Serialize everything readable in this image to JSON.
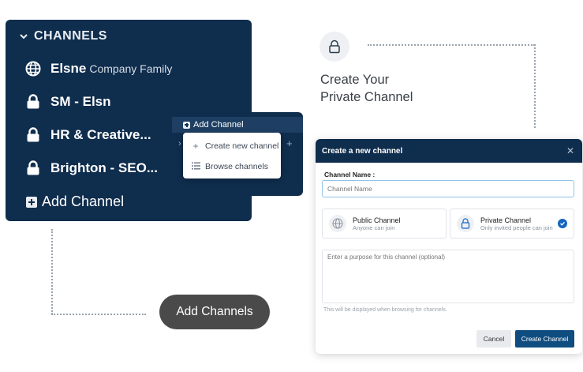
{
  "sidebar": {
    "header": "CHANNELS",
    "items": [
      {
        "name": "Elsne",
        "sub": "Company Family",
        "icon": "globe-icon"
      },
      {
        "name": "SM - Elsn",
        "icon": "lock-icon"
      },
      {
        "name": "HR & Creative...",
        "icon": "lock-icon"
      },
      {
        "name": "Brighton - SEO...",
        "icon": "lock-icon"
      }
    ],
    "add_label": "Add Channel"
  },
  "popover": {
    "strip_label": "Add Channel",
    "menu": [
      "Create new channel",
      "Browse channels"
    ]
  },
  "callouts": {
    "pill": "Add Channels",
    "heading_line1": "Create Your",
    "heading_line2": "Private Channel"
  },
  "modal": {
    "title": "Create a new channel",
    "name_label": "Channel Name :",
    "name_placeholder": "Channel Name",
    "public_title": "Public Channel",
    "public_sub": "Anyone can join",
    "private_title": "Private Channel",
    "private_sub": "Only invited people can join",
    "purpose_placeholder": "Enter a purpose for this channel (optional)",
    "helper": "This will be displayed when browsing for channels.",
    "cancel": "Cancel",
    "create": "Create Channel"
  },
  "colors": {
    "navy": "#0f2d4d",
    "primary": "#0f4d80",
    "check": "#1565c0"
  }
}
